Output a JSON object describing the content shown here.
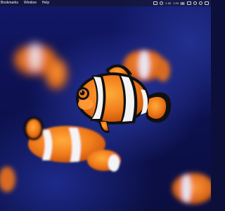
{
  "menubar": {
    "items": [
      {
        "label": "Bookmarks"
      },
      {
        "label": "Window"
      },
      {
        "label": "Help"
      }
    ],
    "status_text_1": "1 02",
    "status_text_2": "1 03",
    "status_icons": [
      "screen-mirror-icon",
      "audio-icon",
      "display-icon",
      "battery-icon",
      "wifi-icon",
      "search-icon",
      "control-center-icon"
    ]
  },
  "wallpaper": {
    "subject": "clownfish",
    "colors": {
      "water": "#121868",
      "fish_orange": "#f07a1a",
      "fish_white": "#f4f4f6",
      "fish_black": "#101010"
    }
  }
}
